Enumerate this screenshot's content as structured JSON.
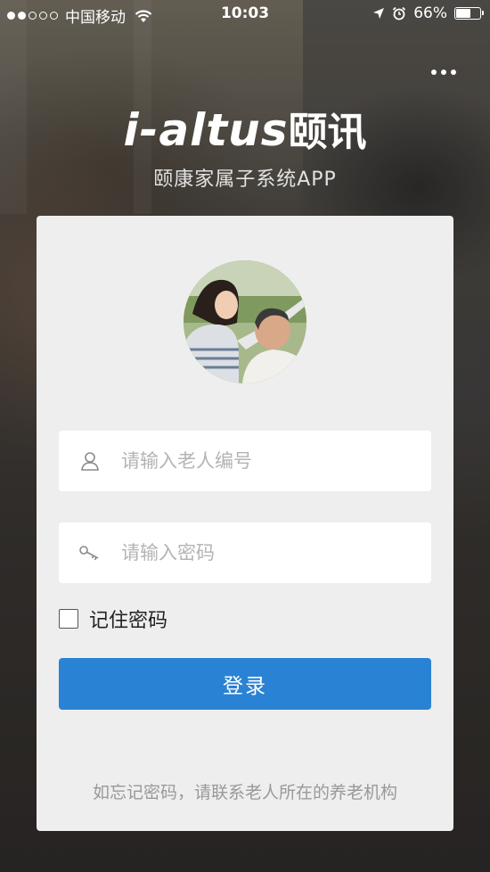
{
  "status_bar": {
    "carrier": "中国移动",
    "time": "10:03",
    "battery_percent_label": "66%",
    "battery_level": 0.66,
    "signal_bars_filled": 2,
    "signal_bars_total": 5
  },
  "header": {
    "brand_latin": "i-altus",
    "brand_cn": "颐讯",
    "subtitle": "颐康家属子系统APP"
  },
  "login": {
    "elder_id_placeholder": "请输入老人编号",
    "elder_id_value": "",
    "password_placeholder": "请输入密码",
    "password_value": "",
    "remember_label": "记住密码",
    "remember_checked": false,
    "submit_label": "登录",
    "forgot_hint": "如忘记密码，请联系老人所在的养老机构"
  },
  "colors": {
    "primary": "#2a82d4",
    "card_bg": "#eeeeee",
    "placeholder": "#b4b4b4"
  },
  "icons": [
    "wifi-icon",
    "location-arrow-icon",
    "alarm-icon",
    "battery-icon",
    "more-dots-icon",
    "user-icon",
    "key-icon"
  ]
}
